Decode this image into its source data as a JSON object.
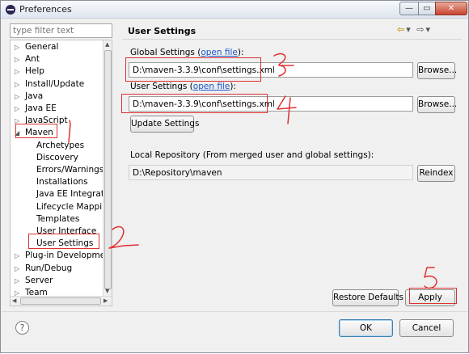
{
  "window": {
    "title": "Preferences"
  },
  "filter": {
    "placeholder": "type filter text"
  },
  "tree": [
    {
      "label": "General",
      "arrow": "▷",
      "indent": 0
    },
    {
      "label": "Ant",
      "arrow": "▷",
      "indent": 0
    },
    {
      "label": "Help",
      "arrow": "▷",
      "indent": 0
    },
    {
      "label": "Install/Update",
      "arrow": "▷",
      "indent": 0
    },
    {
      "label": "Java",
      "arrow": "▷",
      "indent": 0
    },
    {
      "label": "Java EE",
      "arrow": "▷",
      "indent": 0
    },
    {
      "label": "JavaScript",
      "arrow": "▷",
      "indent": 0
    },
    {
      "label": "Maven",
      "arrow": "◢",
      "indent": 0
    },
    {
      "label": "Archetypes",
      "arrow": "",
      "indent": 1
    },
    {
      "label": "Discovery",
      "arrow": "",
      "indent": 1
    },
    {
      "label": "Errors/Warnings",
      "arrow": "",
      "indent": 1
    },
    {
      "label": "Installations",
      "arrow": "",
      "indent": 1
    },
    {
      "label": "Java EE Integration",
      "arrow": "",
      "indent": 1
    },
    {
      "label": "Lifecycle Mapping",
      "arrow": "",
      "indent": 1
    },
    {
      "label": "Templates",
      "arrow": "",
      "indent": 1
    },
    {
      "label": "User Interface",
      "arrow": "",
      "indent": 1
    },
    {
      "label": "User Settings",
      "arrow": "",
      "indent": 1
    },
    {
      "label": "Plug-in Development",
      "arrow": "▷",
      "indent": 0
    },
    {
      "label": "Run/Debug",
      "arrow": "▷",
      "indent": 0
    },
    {
      "label": "Server",
      "arrow": "▷",
      "indent": 0
    },
    {
      "label": "Team",
      "arrow": "▷",
      "indent": 0
    }
  ],
  "page": {
    "title": "User Settings",
    "global_settings_label": "Global Settings (",
    "global_settings_link": "open file",
    "global_settings_suffix": "):",
    "global_settings_value": "D:\\maven-3.3.9\\conf\\settings.xml",
    "user_settings_label": "User Settings (",
    "user_settings_link": "open file",
    "user_settings_suffix": "):",
    "user_settings_value": "D:\\maven-3.3.9\\conf\\settings.xml",
    "browse_label": "Browse...",
    "update_settings_label": "Update Settings",
    "local_repo_label": "Local Repository (From merged user and global settings):",
    "local_repo_value": "D:\\Repository\\maven",
    "reindex_label": "Reindex",
    "restore_defaults_label": "Restore Defaults",
    "apply_label": "Apply"
  },
  "footer": {
    "ok_label": "OK",
    "cancel_label": "Cancel",
    "help_glyph": "?"
  },
  "annotations": {
    "numbers": [
      "1",
      "2",
      "3",
      "4",
      "5"
    ],
    "color": "#e03030"
  }
}
